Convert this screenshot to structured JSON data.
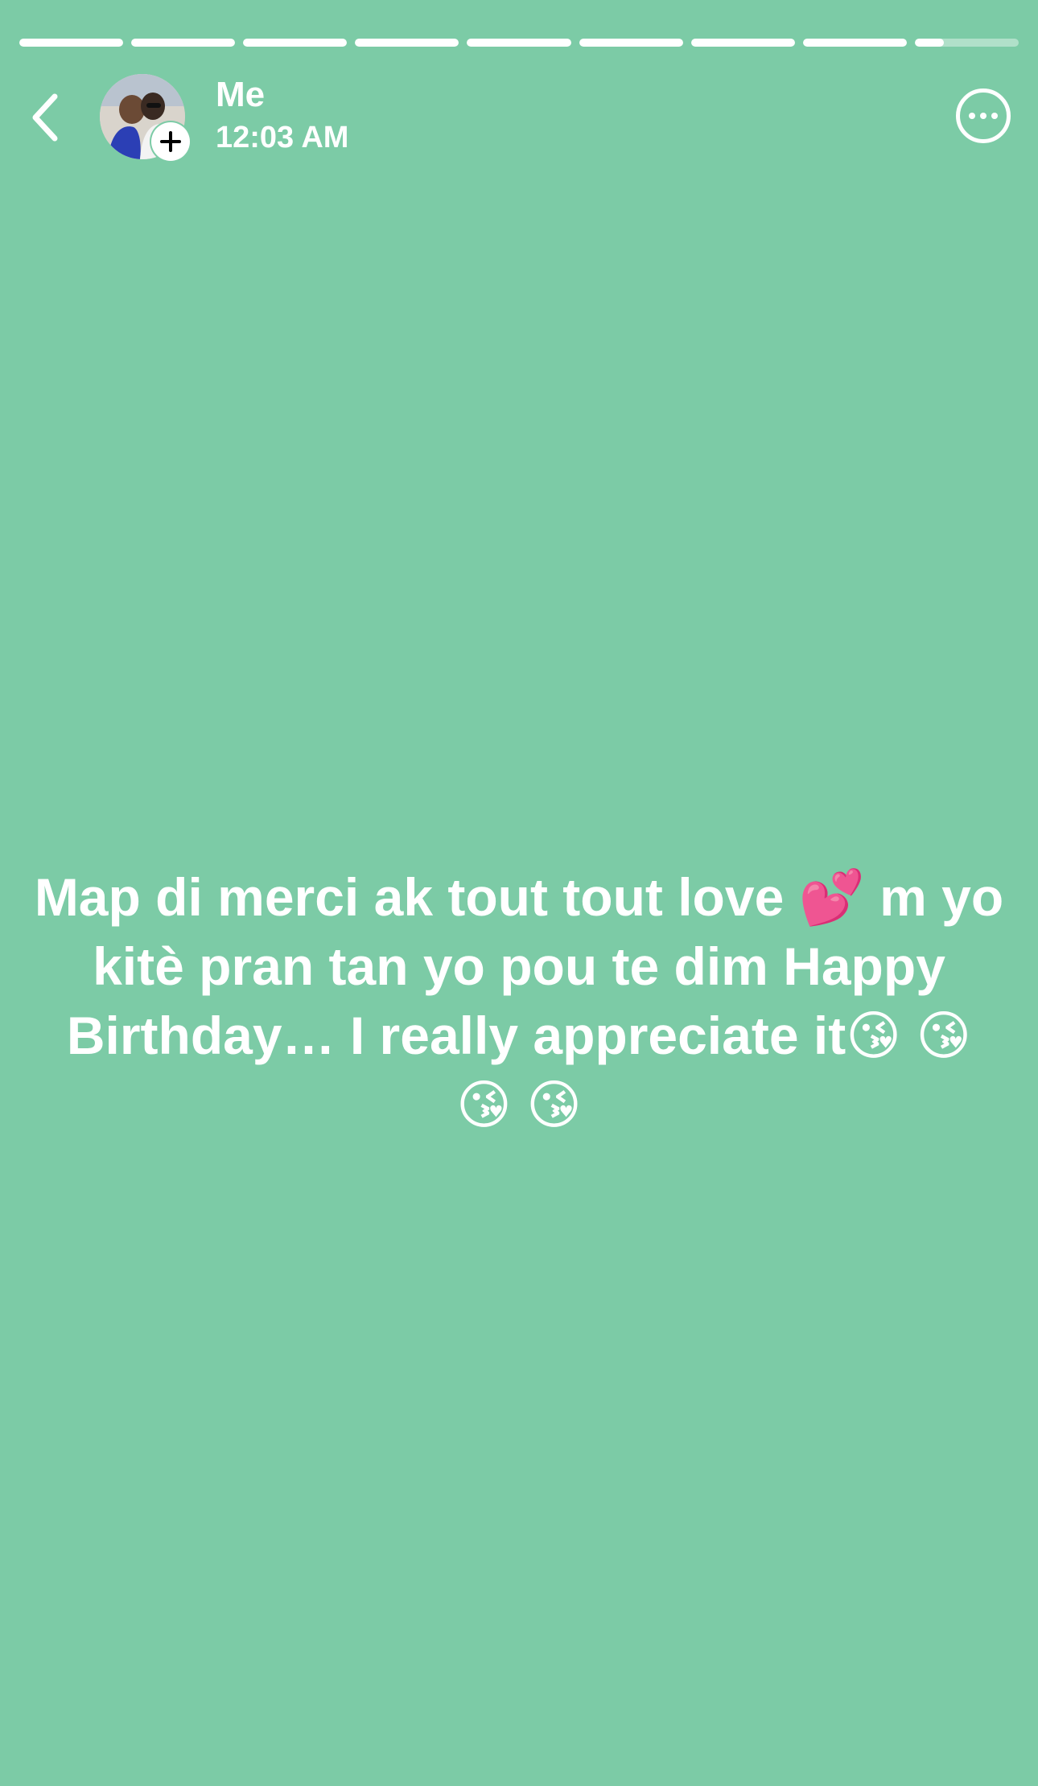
{
  "story": {
    "segments_total": 9,
    "segments_completed": 8,
    "current_segment_progress": 0.28,
    "background_color": "#7CCBA6",
    "text_color": "#FFFFFF"
  },
  "header": {
    "back_icon": "chevron-left-icon",
    "user_name": "Me",
    "time": "12:03 AM",
    "add_icon": "plus-icon",
    "more_icon": "more-horizontal-icon"
  },
  "status_text": "Map di merci ak tout tout love 💕 m yo kitè pran tan yo pou te dim Happy Birthday… I really appreciate it😘 😘 😘 😘"
}
